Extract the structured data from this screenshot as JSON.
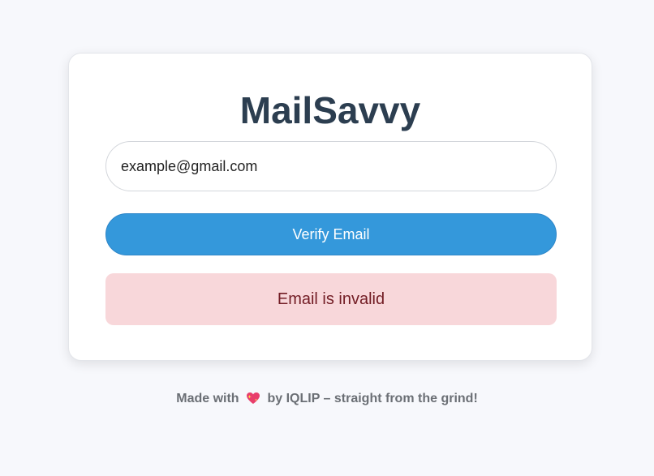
{
  "app": {
    "title": "MailSavvy"
  },
  "form": {
    "email_value": "example@gmail.com",
    "email_placeholder": "",
    "verify_label": "Verify Email"
  },
  "status": {
    "message": "Email is invalid",
    "type": "error"
  },
  "footer": {
    "made_with": "Made with",
    "heart_icon": "sparkling-heart-icon",
    "by_text": "by IQLIP – straight from the grind!"
  },
  "colors": {
    "background": "#f7f8fc",
    "title": "#2c3e50",
    "button": "#3498db",
    "error_bg": "#f8d7da",
    "error_text": "#721c24",
    "heart": "#e83e6c"
  }
}
